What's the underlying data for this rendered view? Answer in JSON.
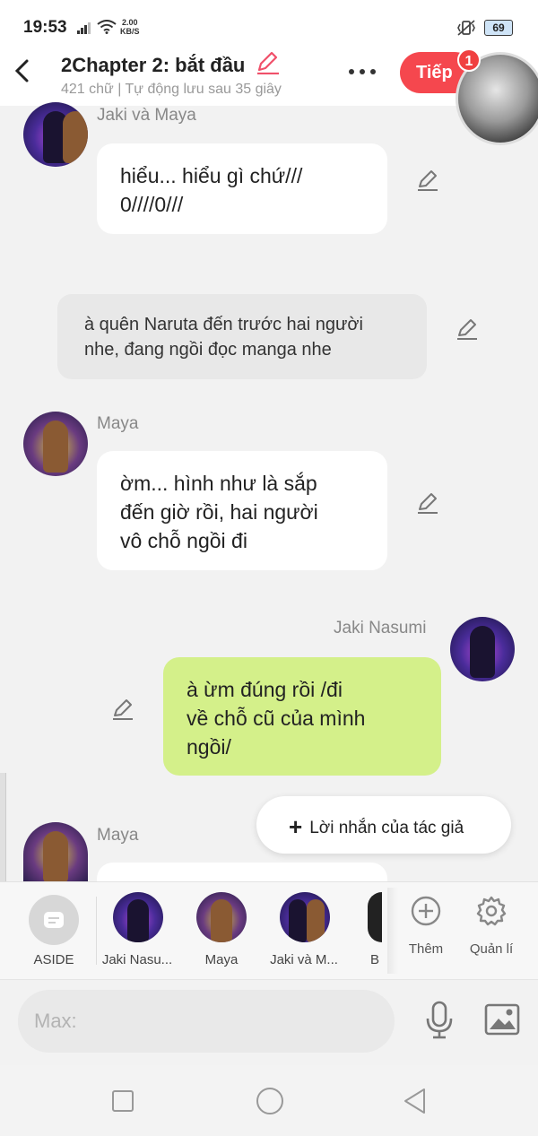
{
  "status_bar": {
    "time": "19:53",
    "speed_top": "2.00",
    "speed_bottom": "KB/S",
    "battery": "69"
  },
  "header": {
    "title": "2Chapter 2: bắt đầu",
    "subtitle": "421 chữ | Tự động lưu sau 35 giây",
    "next_label": "Tiếp",
    "badge_count": "1",
    "accent_color": "#f5474e"
  },
  "messages": [
    {
      "type": "left",
      "name": "Jaki và Maya",
      "text_lines": [
        "hiểu... hiểu gì chứ///",
        "0////0///"
      ]
    },
    {
      "type": "narration",
      "text_lines": [
        "à quên Naruta đến trước hai người",
        "nhe, đang ngồi đọc manga nhe"
      ]
    },
    {
      "type": "left",
      "name": "Maya",
      "text_lines": [
        "ờm... hình như là sắp",
        "đến giờ rồi, hai người",
        "vô chỗ ngồi đi"
      ]
    },
    {
      "type": "right",
      "name": "Jaki Nasumi",
      "text_lines": [
        "à ừm đúng rồi /đi",
        "về chỗ cũ của mình",
        "ngồi/"
      ],
      "bubble_color": "#d4f08a"
    },
    {
      "type": "left",
      "name": "Maya",
      "text_lines": []
    }
  ],
  "author_note_label": "Lời nhắn của tác giả",
  "characters": {
    "aside_label": "ASIDE",
    "items": [
      {
        "label": "Jaki Nasu..."
      },
      {
        "label": "Maya"
      },
      {
        "label": "Jaki và M..."
      },
      {
        "label": "B"
      }
    ],
    "add_label": "Thêm",
    "manage_label": "Quản lí"
  },
  "input": {
    "placeholder": "Max:"
  }
}
